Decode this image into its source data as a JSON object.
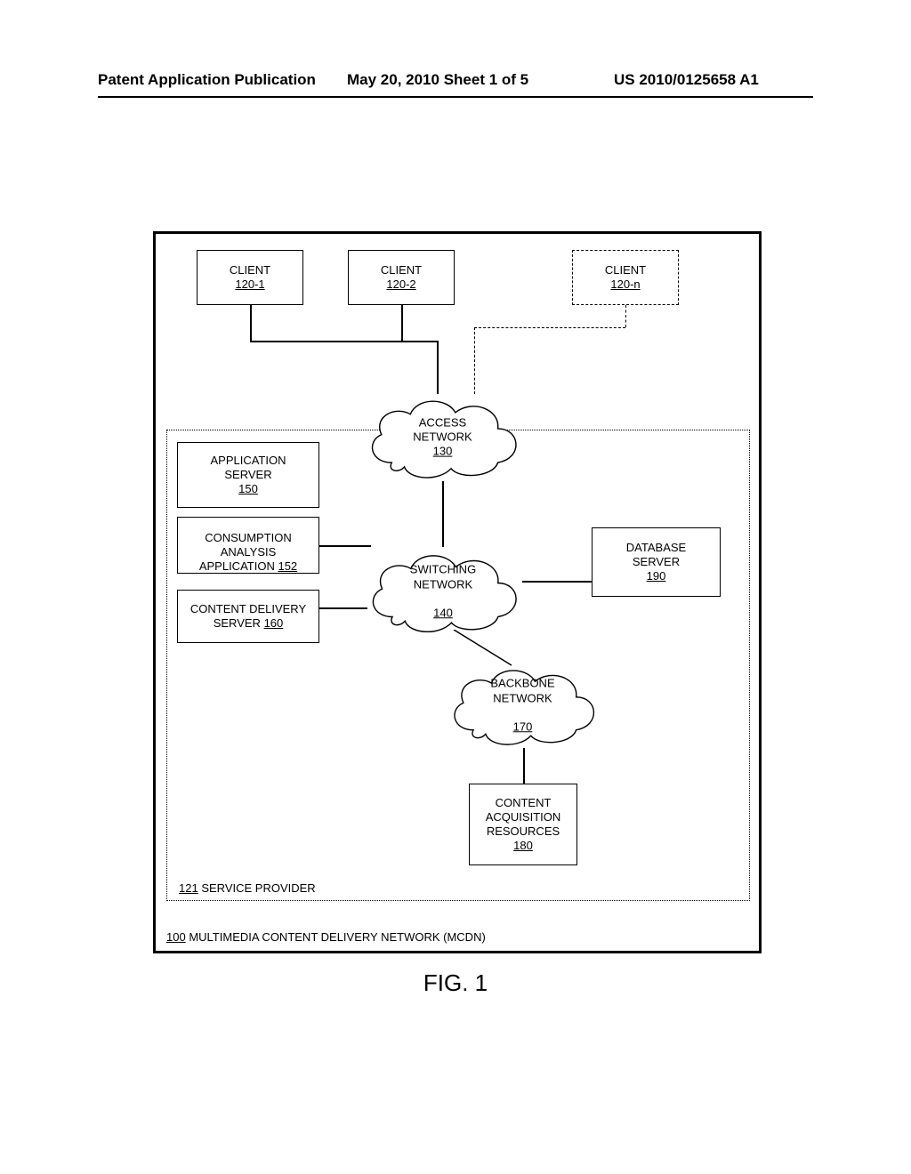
{
  "header": {
    "left": "Patent Application Publication",
    "mid": "May 20, 2010  Sheet 1 of 5",
    "right": "US 2010/0125658 A1"
  },
  "clients": [
    {
      "label": "CLIENT",
      "ref": "120-1"
    },
    {
      "label": "CLIENT",
      "ref": "120-2"
    },
    {
      "label": "CLIENT",
      "ref": "120-n"
    }
  ],
  "clouds": {
    "access": {
      "label": "ACCESS NETWORK",
      "ref": "130"
    },
    "switching": {
      "label": "SWITCHING\nNETWORK",
      "ref": "140"
    },
    "backbone": {
      "label": "BACKBONE\nNETWORK",
      "ref": "170"
    }
  },
  "boxes": {
    "appserver": {
      "label": "APPLICATION\nSERVER",
      "ref": "150"
    },
    "consumption": {
      "label": "CONSUMPTION\nANALYSIS\nAPPLICATION",
      "ref": "152"
    },
    "content_delivery": {
      "label": "CONTENT DELIVERY\nSERVER",
      "ref": "160"
    },
    "db": {
      "label": "DATABASE\nSERVER",
      "ref": "190"
    },
    "car": {
      "label": "CONTENT\nACQUISITION\nRESOURCES",
      "ref": "180"
    }
  },
  "service_provider": {
    "ref": "121",
    "label": "SERVICE PROVIDER"
  },
  "mcdn": {
    "ref": "100",
    "label": "MULTIMEDIA CONTENT DELIVERY NETWORK (MCDN)"
  },
  "figure": "FIG. 1"
}
